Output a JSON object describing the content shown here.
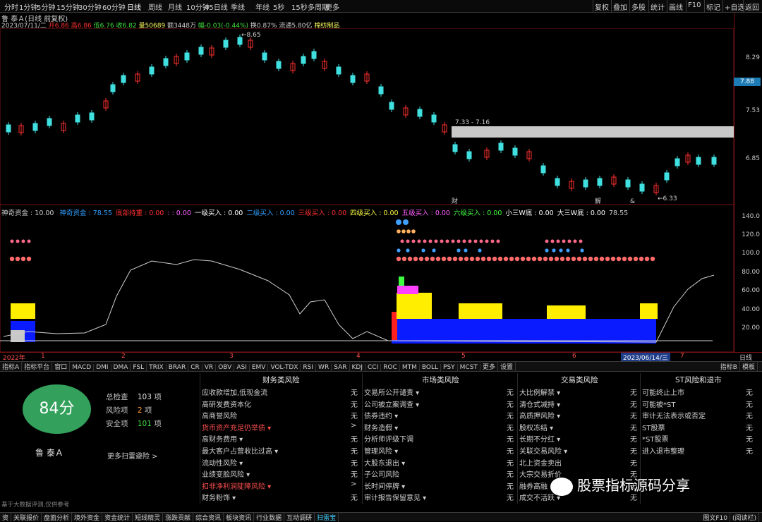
{
  "toolbar": {
    "timeframes": [
      "分时",
      "1分钟",
      "5分钟",
      "15分钟",
      "30分钟",
      "60分钟",
      "日线",
      "周线",
      "月线",
      "10分钟",
      "45日线",
      "季线",
      "年线",
      "5秒",
      "15秒",
      "多周期",
      "更多"
    ],
    "active_timeframe": "日线",
    "right_buttons": [
      "复权",
      "叠加",
      "多股",
      "统计",
      "画线",
      "F10",
      "标记",
      "+自选",
      "返回"
    ]
  },
  "stock": {
    "title": "鲁 泰Ａ(日线 前复权)",
    "date": "2023/07/11/二",
    "open_label": "开",
    "open": "6.86",
    "high_label": "高",
    "high": "6.86",
    "low_label": "低",
    "low": "6.76",
    "close_label": "收",
    "close": "6.82",
    "vol_label": "量",
    "volume": "50689",
    "amt_label": "额",
    "amount": "3448万",
    "chg_label": "幅",
    "change": "-0.03(-0.44%)",
    "turnover": "换0.87%",
    "float_label": "流通",
    "float_value": "5.80亿",
    "industry": "棉纺制品"
  },
  "price_chart": {
    "yticks": [
      "8.29",
      "7.53",
      "6.85"
    ],
    "extra_ytick": "7.88",
    "current_price_tag": "7.88",
    "high_marker": "8.65",
    "low_marker": "6.33",
    "gap_label": "7.33 - 7.16",
    "event_labels": [
      "财",
      "解",
      "&"
    ]
  },
  "indicator": {
    "name": "神奇资金",
    "param": "10.00",
    "items": [
      {
        "label": "神奇资金",
        "value": "78.55",
        "color": "#2fa0ff"
      },
      {
        "label": "底部持重",
        "value": "0.00",
        "color": "#ff3030"
      },
      {
        "label": ":",
        "value": "0.00",
        "color": "#ff60ff"
      },
      {
        "label": "一级买入",
        "value": "0.00",
        "color": "#ffffff"
      },
      {
        "label": "二级买入",
        "value": "0.00",
        "color": "#2fa0ff"
      },
      {
        "label": "三级买入",
        "value": "0.00",
        "color": "#ff3030"
      },
      {
        "label": "四级买入",
        "value": "0.00",
        "color": "#ffff40"
      },
      {
        "label": "五级买入",
        "value": "0.00",
        "color": "#ff60ff"
      },
      {
        "label": "六级买入",
        "value": "0.00",
        "color": "#40ff40"
      },
      {
        "label": "小三W底",
        "value": "0.00",
        "color": "#ffffff"
      },
      {
        "label": "大三W底",
        "value": "0.00",
        "color": "#ffffff"
      },
      {
        "label": "",
        "value": "78.55",
        "color": "#cfcfcf"
      }
    ],
    "yticks": [
      "140.0",
      "120.0",
      "100.0",
      "80.00",
      "60.00",
      "40.00",
      "20.00"
    ]
  },
  "bottom_axis": {
    "labels": [
      "2022年",
      "1",
      "2",
      "3",
      "4",
      "5",
      "6",
      "7"
    ],
    "date_badge": "2023/06/14/三",
    "right_label": "日线"
  },
  "tabs": [
    "指标A",
    "指标平台",
    "窗口",
    "MACD",
    "DMI",
    "DMA",
    "FSL",
    "TRIX",
    "BRAR",
    "CR",
    "VR",
    "OBV",
    "ASI",
    "EMV",
    "VOL-TDX",
    "RSI",
    "WR",
    "SAR",
    "KDJ",
    "CCI",
    "ROC",
    "MTM",
    "BOLL",
    "PSY",
    "MCST",
    "更多",
    "设置"
  ],
  "tabs_right": [
    "指标B",
    "模板"
  ],
  "scan": {
    "score": "84分",
    "stock_name": "鲁 泰Ａ",
    "total_label": "总检查",
    "total": "103",
    "unit": "项",
    "risk_label": "风险项",
    "risk": "2",
    "safe_label": "安全项",
    "safe": "101",
    "more_link": "更多扫雷避险 >",
    "disclaimer": "基于大数据评测,仅供参考"
  },
  "risk_columns": [
    {
      "title": "财务类风险",
      "rows": [
        {
          "label": "应收款增加,低现金流",
          "value": "无",
          "alert": false
        },
        {
          "label": "高研发费资本化",
          "value": "无",
          "alert": false
        },
        {
          "label": "高商誉风险",
          "value": "无",
          "alert": false
        },
        {
          "label": "货币资产充足仍举债 ▾",
          "value": ">",
          "alert": true
        },
        {
          "label": "高财务费用 ▾",
          "value": "无",
          "alert": false
        },
        {
          "label": "最大客户占营收比过高 ▾",
          "value": "无",
          "alert": false
        },
        {
          "label": "流动性风险 ▾",
          "value": "无",
          "alert": false
        },
        {
          "label": "业绩变脸风险 ▾",
          "value": "无",
          "alert": false
        },
        {
          "label": "扣非净利润陡降风险 ▾",
          "value": ">",
          "alert": true
        },
        {
          "label": "财务粉饰 ▾",
          "value": "无",
          "alert": false
        }
      ]
    },
    {
      "title": "市场类风险",
      "rows": [
        {
          "label": "交易所公开谴责 ▾",
          "value": "无",
          "alert": false
        },
        {
          "label": "公司被立案调查 ▾",
          "value": "无",
          "alert": false
        },
        {
          "label": "债券违约 ▾",
          "value": "无",
          "alert": false
        },
        {
          "label": "财务造假 ▾",
          "value": "无",
          "alert": false
        },
        {
          "label": "分析师评级下调",
          "value": "无",
          "alert": false
        },
        {
          "label": "管理风险 ▾",
          "value": "无",
          "alert": false
        },
        {
          "label": "大股东退出 ▾",
          "value": "无",
          "alert": false
        },
        {
          "label": "子公司风险",
          "value": "无",
          "alert": false
        },
        {
          "label": "长时间停牌 ▾",
          "value": "无",
          "alert": false
        },
        {
          "label": "审计报告保留意见 ▾",
          "value": "无",
          "alert": false
        }
      ]
    },
    {
      "title": "交易类风险",
      "rows": [
        {
          "label": "大比例解禁 ▾",
          "value": "无",
          "alert": false
        },
        {
          "label": "清仓式减持 ▾",
          "value": "无",
          "alert": false
        },
        {
          "label": "高质押风险 ▾",
          "value": "无",
          "alert": false
        },
        {
          "label": "股权冻结 ▾",
          "value": "无",
          "alert": false
        },
        {
          "label": "长期不分红 ▾",
          "value": "无",
          "alert": false
        },
        {
          "label": "关联交易风险 ▾",
          "value": "无",
          "alert": false
        },
        {
          "label": "北上资金卖出",
          "value": "无",
          "alert": false
        },
        {
          "label": "大宗交易折价",
          "value": "无",
          "alert": false
        },
        {
          "label": "融券高融",
          "value": "无",
          "alert": false
        },
        {
          "label": "成交不活跃 ▾",
          "value": "无",
          "alert": false
        }
      ]
    },
    {
      "title": "ST风险和退市",
      "rows": [
        {
          "label": "可能终止上市",
          "value": "无",
          "alert": false
        },
        {
          "label": "可能被*ST",
          "value": "无",
          "alert": false
        },
        {
          "label": "审计无法表示或否定",
          "value": "无",
          "alert": false
        },
        {
          "label": "ST股票",
          "value": "无",
          "alert": false
        },
        {
          "label": "*ST股票",
          "value": "无",
          "alert": false
        },
        {
          "label": "进入退市整理",
          "value": "无",
          "alert": false
        }
      ]
    }
  ],
  "bottom_tabs": [
    "资",
    "关联报价",
    "盘面分析",
    "境外资金",
    "资金统计",
    "短线精灵",
    "涨跌贡献",
    "综合资讯",
    "板块资讯",
    "行业数据",
    "互动调研",
    "扫雷宝"
  ],
  "bottom_right": [
    "图文F10",
    "(阅读栏)"
  ],
  "watermark": "股票指标源码分享",
  "colors": {
    "up": "#ff3030",
    "down": "#40e0e0",
    "accent": "#33a05c",
    "alert": "#ff5050"
  }
}
